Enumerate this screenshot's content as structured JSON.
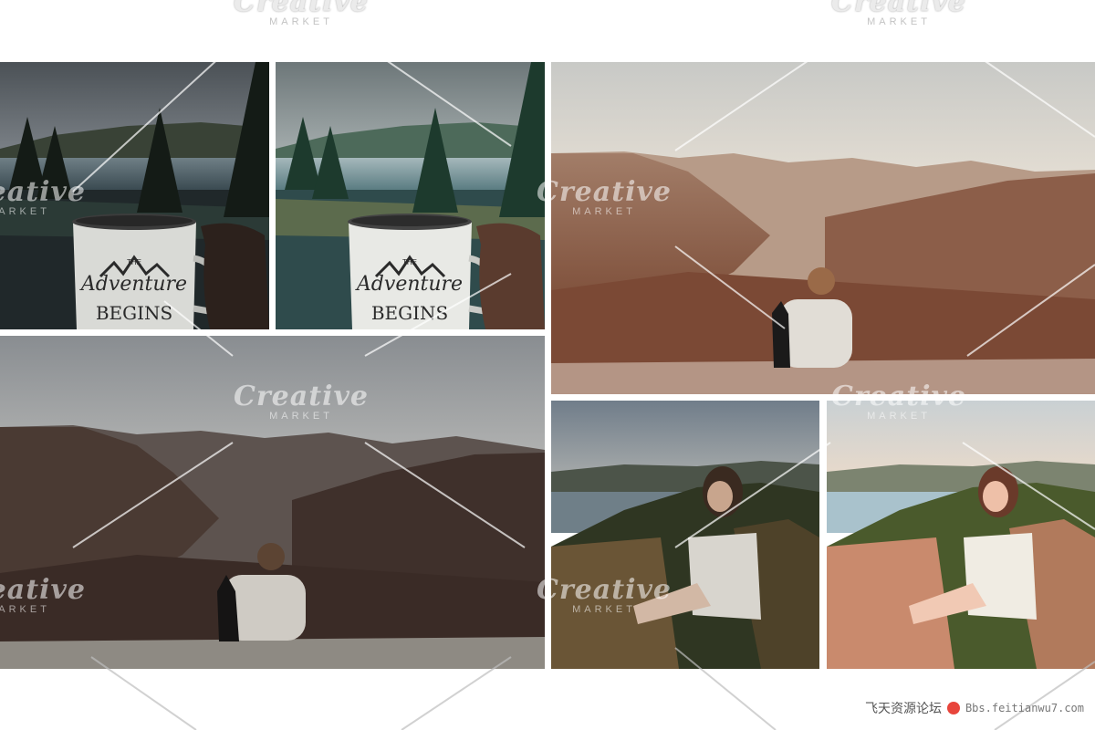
{
  "watermark": {
    "brand": "Creative",
    "sub": "MARKET"
  },
  "mug": {
    "line1": "THE",
    "line2": "Adventure",
    "line3": "BEGINS"
  },
  "footer": {
    "site": "飞天资源论坛",
    "url": "Bbs.feitianwu7.com"
  },
  "colors": {
    "background": "#ffffff",
    "watermark": "#ffffff"
  }
}
